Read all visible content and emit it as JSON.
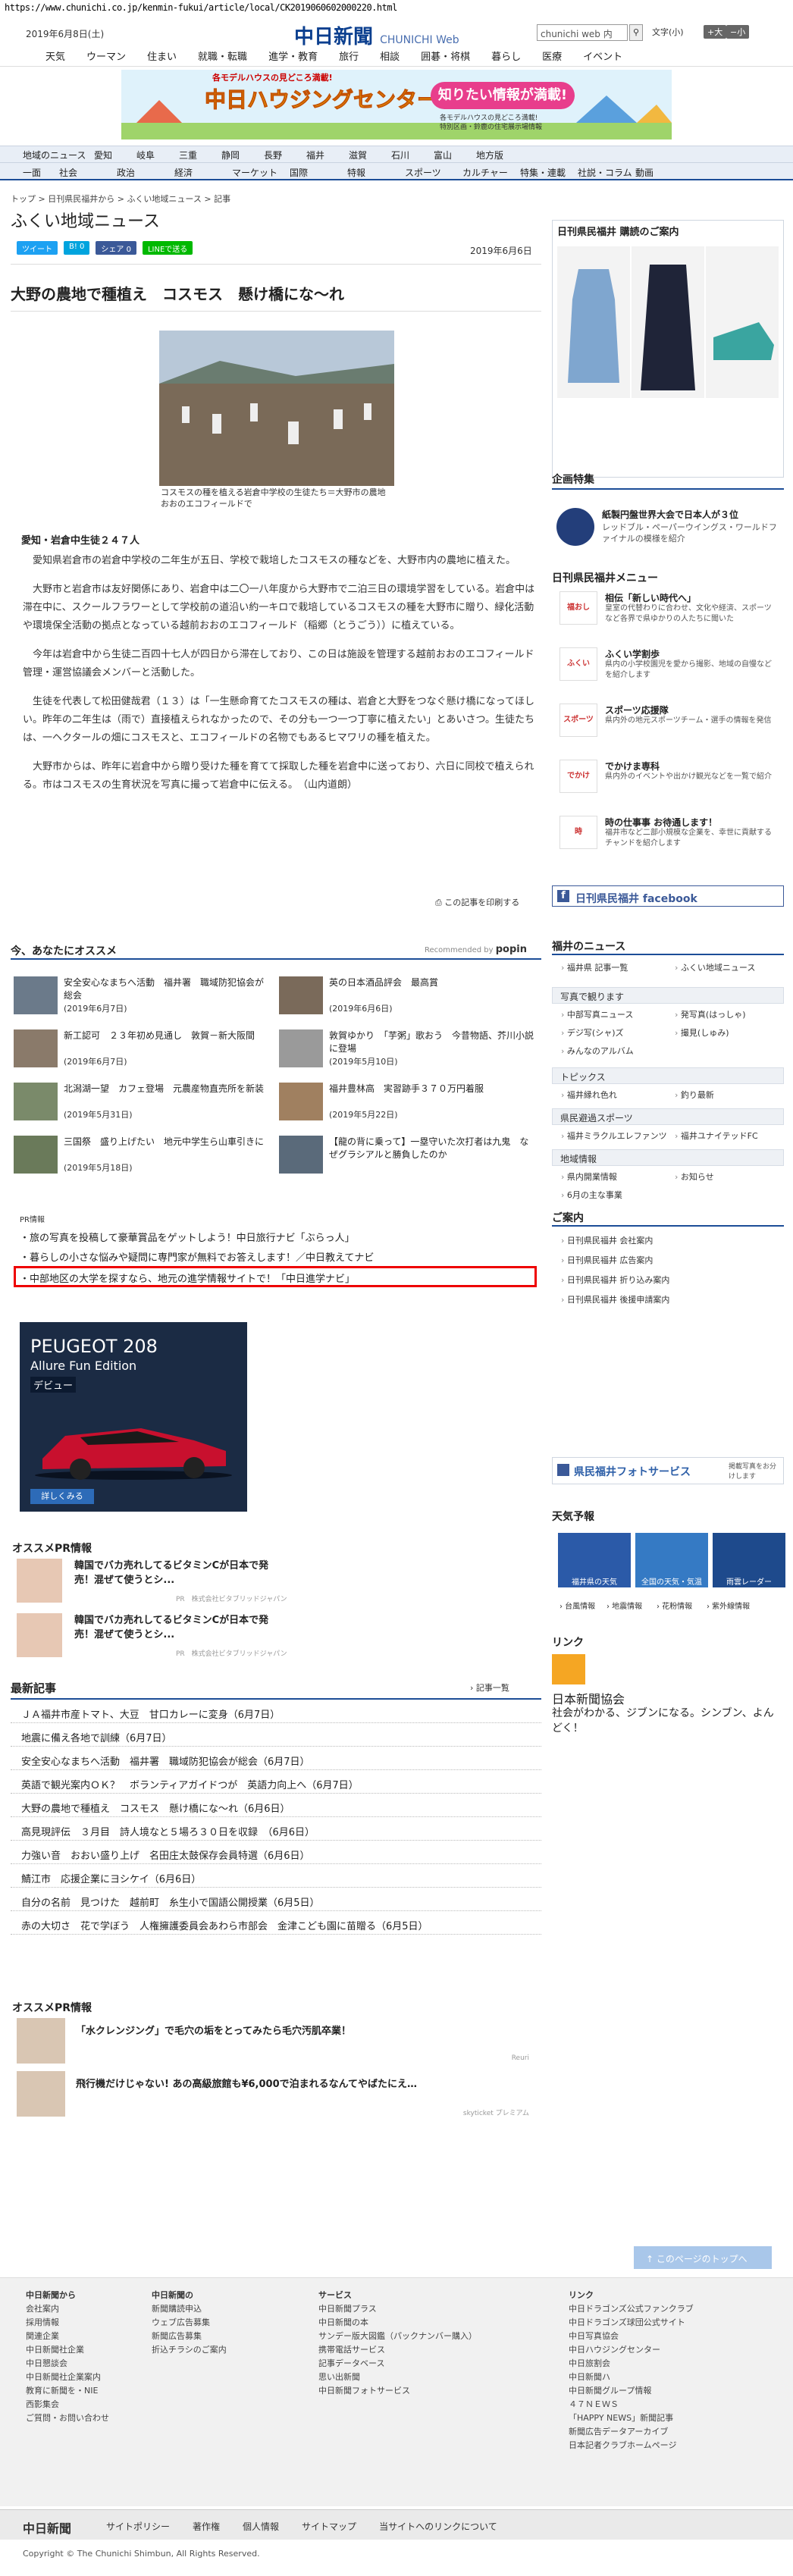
{
  "url": "https://www.chunichi.co.jp/kenmin-fukui/article/local/CK2019060602000220.html",
  "header": {
    "date": "2019年6月8日(土)",
    "logo": "中日新聞",
    "logo_web": "CHUNICHI Web",
    "search_placeholder": "chunichi web 内",
    "font_label": "文字",
    "font_note": "(小)",
    "font_big": "大",
    "font_small": "小",
    "nav": [
      "天気",
      "ウーマン",
      "住まい",
      "就職・転職",
      "進学・教育",
      "旅行",
      "相談",
      "囲碁・将棋",
      "暮らし",
      "医療",
      "イベント"
    ]
  },
  "banner": {
    "top": "各モデルハウスの見どころ満載!",
    "title": "中日ハウジングセンター",
    "badge": "知りたい情報が満載!",
    "sub": "各モデルハウスの見どころ満載!",
    "sub2": "特別区画・鈴鹿の住宅展示場情報"
  },
  "catnav1": [
    "地域のニュース",
    "愛知",
    "岐阜",
    "三重",
    "静岡",
    "長野",
    "福井",
    "滋賀",
    "石川",
    "富山",
    "地方版"
  ],
  "catnav2": [
    "一面",
    "社会",
    "政治",
    "経済",
    "マーケット",
    "国際",
    "特報",
    "スポーツ",
    "カルチャー",
    "特集・連載",
    "社説・コラム",
    "動画"
  ],
  "breadcrumb": "トップ > 日刊県民福井から > ふくい地域ニュース > 記事",
  "section_title": "ふくい地域ニュース",
  "share": {
    "tweet": "ツイート",
    "hatena": "B! 0",
    "fb": "シェア 0",
    "line": "LINEで送る"
  },
  "article": {
    "date": "2019年6月6日",
    "headline": "大野の農地で種植え　コスモス　懸け橋にな～れ",
    "caption": "コスモスの種を植える岩倉中学校の生徒たち＝大野市の農地おおのエコフィールドで",
    "subhead": "愛知・岩倉中生徒２４７人",
    "paragraphs": [
      "愛知県岩倉市の岩倉中学校の二年生が五日、学校で栽培したコスモスの種などを、大野市内の農地に植えた。",
      "大野市と岩倉市は友好関係にあり、岩倉中は二〇一八年度から大野市で二泊三日の環境学習をしている。岩倉中は滞在中に、スクールフラワーとして学校前の道沿い約一キロで栽培しているコスモスの種を大野市に贈り、緑化活動や環境保全活動の拠点となっている越前おおのエコフィールド（稲郷（とうごう））に植えている。",
      "今年は岩倉中から生徒二百四十七人が四日から滞在しており、この日は施設を管理する越前おおのエコフィールド管理・運営協議会メンバーと活動した。",
      "生徒を代表して松田健哉君（１３）は「一生懸命育てたコスモスの種は、岩倉と大野をつなぐ懸け橋になってほしい。昨年の二年生は（雨で）直接植えられなかったので、その分も一つ一つ丁寧に植えたい」とあいさつ。生徒たちは、一ヘクタールの畑にコスモスと、エコフィールドの名物でもあるヒマワリの種を植えた。",
      "大野市からは、昨年に岩倉中から贈り受けた種を育てて採取した種を岩倉中に送っており、六日に同校で植えられる。市はコスモスの生育状況を写真に撮って岩倉中に伝える。　（山内道朗）"
    ],
    "print": "この記事を印刷する"
  },
  "recommend": {
    "title": "今、あなたにオススメ",
    "by": "Recommended by",
    "brand": "popin",
    "items": [
      {
        "title": "安全安心なまちへ活動　福井署　職域防犯協会が総会",
        "date": "(2019年6月7日)"
      },
      {
        "title": "英の日本酒品評会　最高賞",
        "date": "(2019年6月6日)"
      },
      {
        "title": "新工認可　２３年初め見通し　敦賀－新大阪間",
        "date": "(2019年6月7日)"
      },
      {
        "title": "敦賀ゆかり　「芋粥」歌おう　今昔物語、芥川小説に登場",
        "date": "(2019年5月10日)"
      },
      {
        "title": "北潟湖一望　カフェ登場　元農産物直売所を新装",
        "date": "(2019年5月31日)"
      },
      {
        "title": "福井豊林高　実習跡手３７０万円着服",
        "date": "(2019年5月22日)"
      },
      {
        "title": "三国祭　盛り上げたい　地元中学生ら山車引きに",
        "date": "(2019年5月18日)"
      },
      {
        "title": "【龍の背に乗って】一塁守いた次打者は九鬼　なぜグラシアルと勝負したのか",
        "date": ""
      }
    ]
  },
  "pr": {
    "label": "PR情報",
    "links": [
      "・旅の写真を投稿して豪華賞品をゲットしよう！中日旅行ナビ「ぶらっ人」",
      "・暮らしの小さな悩みや疑問に専門家が無料でお答えします！／中日教えてナビ",
      "・中部地区の大学を探すなら、地元の進学情報サイトで！「中日進学ナビ」"
    ]
  },
  "car_ad": {
    "model": "PEUGEOT 208",
    "edition": "Allure Fun Edition",
    "debut": "デビュー",
    "btn": "詳しくみる"
  },
  "osusume_pr": {
    "title": "オススメPR情報",
    "items": [
      {
        "text": "韓国でバカ売れしてるビタミンCが日本で発売！混ぜて使うとシ...",
        "src": "PR　株式会社ビタブリッドジャパン"
      },
      {
        "text": "韓国でバカ売れしてるビタミンCが日本で発売！混ぜて使うとシ...",
        "src": "PR　株式会社ビタブリッドジャパン"
      }
    ]
  },
  "latest": {
    "title": "最新記事",
    "btn": "記事一覧",
    "items": [
      "ＪＡ福井市産トマト、大豆　甘口カレーに変身（6月7日）",
      "地震に備え各地で訓練（6月7日）",
      "安全安心なまちへ活動　福井署　職域防犯協会が総会（6月7日）",
      "英語で観光案内ＯＫ？　ボランティアガイドつが　英語力向上へ（6月7日）",
      "大野の農地で種植え　コスモス　懸け橋にな～れ（6月6日）",
      "高見現評伝　３月目　詩人境なと５場ろ３０日を収録　（6月6日）",
      "力強い音　おおい盛り上げ　名田庄太鼓保存会員特選（6月6日）",
      "鯖江市　応援企業にヨシケイ（6月6日）",
      "自分の名前　見つけた　越前町　糸生小で国語公開授業（6月5日）",
      "赤の大切さ　花で学ぼう　人権擁護委員会あわら市部会　金津こども園に苗贈る（6月5日）"
    ]
  },
  "osusume_pr2": {
    "title": "オススメPR情報",
    "items": [
      {
        "text": "「水クレンジング」で毛穴の垢をとってみたら毛穴汚肌卒業！",
        "src": "Reuri"
      },
      {
        "text": "飛行機だけじゃない! あの高級旅館も¥6,000で泊まれるなんてやばたにえ…",
        "src": "skyticket プレミアム"
      }
    ]
  },
  "side": {
    "subscribe": "日刊県民福井 購読のご案内",
    "kikaku": "企画特集",
    "kikaku_title": "紙製円盤世界大会で日本人が３位",
    "kikaku_desc": "レッドブル・ペーパーウイングス・ワールドファイナルの模様を紹介",
    "hmenu": "日刊県民福井メニュー",
    "hm": [
      {
        "icon": "福おし",
        "title": "相伝「新しい時代へ」",
        "desc": "皇室の代替わりに合わせ、文化や経済、スポーツなど各界で県ゆかりの人たちに聞いた"
      },
      {
        "icon": "ふくい",
        "title": "ふくい学割歩",
        "desc": "県内の小学校園児を愛から撮影、地域の自慢などを紹介します"
      },
      {
        "icon": "スポーツ",
        "title": "スポーツ応援隊",
        "desc": "県内外の地元スポーツチーム・選手の情報を発信"
      },
      {
        "icon": "でかけ",
        "title": "でかけま専科",
        "desc": "県内外のイベントや出かけ観光などを一覧で紹介"
      },
      {
        "icon": "時",
        "title": "時の仕事事 お待通します！",
        "desc": "福井市など二部小規模な企業を、幸世に貢献するチャンドを紹介します"
      }
    ],
    "facebook": "日刊県民福井 facebook",
    "fukui_news": "福井のニュース",
    "fn_links": [
      "福井県 記事一覧",
      "ふくい地域ニュース",
      "写真で観ります"
    ],
    "fn_links2": [
      "中部写真ニュース",
      "発写真(はっしゃ)",
      "デジ写(シャ)ズ",
      "撮見(しゅみ)",
      "みんなのアルバム"
    ],
    "topics": "トピックス",
    "topics_links": [
      "福井縁れ色れ",
      "釣り最新"
    ],
    "sports": "県民避過スポーツ",
    "sports_links": [
      "福井ミラクルエレファンツ",
      "福井ユナイテッドFC"
    ],
    "chiiki": "地域情報",
    "chiiki_links": [
      "県内開業情報",
      "お知らせ",
      "6月の主な事業"
    ],
    "annai": "ご案内",
    "annai_links": [
      "日刊県民福井 会社案内",
      "日刊県民福井 広告案内",
      "日刊県民福井 折り込み案内",
      "日刊県民福井 後援申請案内"
    ],
    "photo": "県民福井フォトサービス",
    "photo_sub": "掲載写真をお分けします",
    "tenki": "天気予報",
    "w": [
      "福井県の天気",
      "全国の天気・気温",
      "雨雲レーダー"
    ],
    "wlinks": [
      "› 台風情報",
      "› 地震情報",
      "› 花粉情報",
      "› 紫外線情報"
    ],
    "link": "リンク",
    "jna": "日本新聞協会",
    "jna_desc": "社会がわかる、ジブンになる。シンブン、よんどく！"
  },
  "totop": "このページのトップへ",
  "footer": {
    "c1": [
      "中日新聞から",
      "会社案内",
      "採用情報",
      "関連企業",
      "中日新聞社企業",
      "中日懇談会",
      "中日新聞社企業案内",
      "教育に新聞を・NIE",
      "西影集会",
      "ご質問・お問い合わせ"
    ],
    "c2": [
      "中日新聞の",
      "新聞購読申込",
      "ウェブ広告募集",
      "新聞広告募集",
      "折込チラシのご案内"
    ],
    "c3": [
      "サービス",
      "中日新聞プラス",
      "中日新聞の本",
      "サンデー版大図鑑（パックナンバー購入）",
      "携帯電話サービス",
      "記事データベース",
      "思い出新聞",
      "中日新聞フォトサービス"
    ],
    "c4": [
      "リンク",
      "中日ドラゴンズ公式ファンクラブ",
      "中日ドラゴンズ球団公式サイト",
      "中日写真協会",
      "中日ハウジングセンター",
      "中日旅割会",
      "中日新聞ハ",
      "中日新聞グループ情報",
      "４７ＮＥＷＳ",
      "「HAPPY NEWS」新聞記事",
      "新聞広告データアーカイブ",
      "日本記者クラブホームページ"
    ],
    "logo": "中日新聞",
    "nav": [
      "サイトポリシー",
      "著作権",
      "個人情報",
      "サイトマップ",
      "当サイトへのリンクについて"
    ],
    "copy": "Copyright © The Chunichi Shimbun, All Rights Reserved."
  }
}
